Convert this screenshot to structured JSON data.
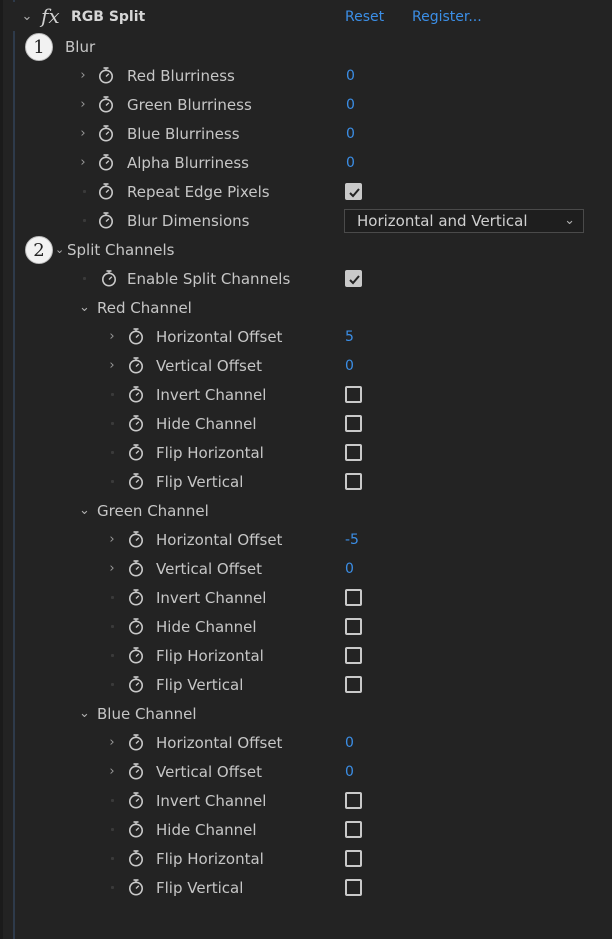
{
  "effect": {
    "title": "RGB Split",
    "fx_label": "fx",
    "reset_label": "Reset",
    "register_label": "Register..."
  },
  "badges": {
    "one": "1",
    "two": "2"
  },
  "blur": {
    "group_label": "Blur",
    "red_blurriness": {
      "label": "Red Blurriness",
      "value": "0"
    },
    "green_blurriness": {
      "label": "Green Blurriness",
      "value": "0"
    },
    "blue_blurriness": {
      "label": "Blue Blurriness",
      "value": "0"
    },
    "alpha_blurriness": {
      "label": "Alpha Blurriness",
      "value": "0"
    },
    "repeat_edge": {
      "label": "Repeat Edge Pixels",
      "checked": true
    },
    "dimensions": {
      "label": "Blur Dimensions",
      "value": "Horizontal and Vertical"
    }
  },
  "split": {
    "group_label": "Split Channels",
    "enable": {
      "label": "Enable Split Channels",
      "checked": true
    },
    "red": {
      "label": "Red Channel",
      "h_offset": {
        "label": "Horizontal Offset",
        "value": "5"
      },
      "v_offset": {
        "label": "Vertical Offset",
        "value": "0"
      },
      "invert": "Invert Channel",
      "hide": "Hide Channel",
      "flip_h": "Flip Horizontal",
      "flip_v": "Flip Vertical"
    },
    "green": {
      "label": "Green Channel",
      "h_offset": {
        "label": "Horizontal Offset",
        "value": "-5"
      },
      "v_offset": {
        "label": "Vertical Offset",
        "value": "0"
      },
      "invert": "Invert Channel",
      "hide": "Hide Channel",
      "flip_h": "Flip Horizontal",
      "flip_v": "Flip Vertical"
    },
    "blue": {
      "label": "Blue Channel",
      "h_offset": {
        "label": "Horizontal Offset",
        "value": "0"
      },
      "v_offset": {
        "label": "Vertical Offset",
        "value": "0"
      },
      "invert": "Invert Channel",
      "hide": "Hide Channel",
      "flip_h": "Flip Horizontal",
      "flip_v": "Flip Vertical"
    }
  },
  "colors": {
    "accent": "#3b8ee6",
    "background": "#232323",
    "text": "#c6c6c6"
  }
}
